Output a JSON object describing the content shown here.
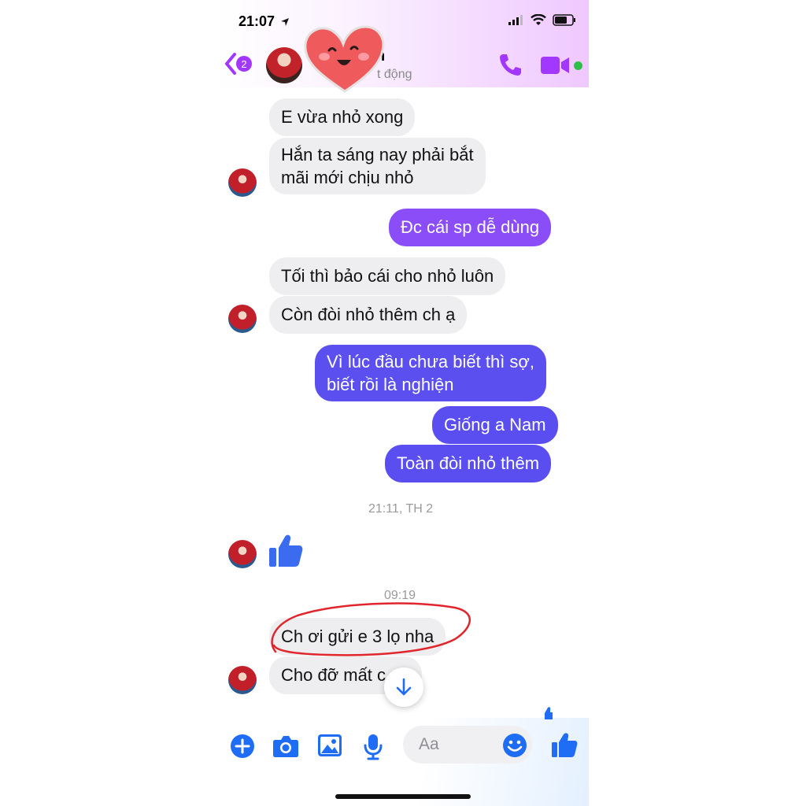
{
  "status_bar": {
    "time": "21:07"
  },
  "header": {
    "unread_count": "2",
    "contact_name": "h",
    "contact_status": "t động"
  },
  "messages": [
    {
      "text": "E vừa nhỏ xong"
    },
    {
      "text_line1": "Hắn ta sáng nay phải bắt",
      "text_line2": "mãi mới chịu nhỏ"
    },
    {
      "text": "Đc cái sp dễ dùng"
    },
    {
      "text": "Tối thì bảo cái cho nhỏ luôn"
    },
    {
      "text": "Còn đòi nhỏ thêm ch ạ"
    },
    {
      "text_line1": "Vì lúc đầu chưa biết thì sợ,",
      "text_line2": "biết rồi là nghiện"
    },
    {
      "text": "Giống a Nam"
    },
    {
      "text": "Toàn đòi nhỏ thêm"
    },
    {
      "text": "Ch ơi gửi e 3 lọ nha"
    },
    {
      "text": "Cho đỡ mất c ng"
    }
  ],
  "timestamps": [
    "21:11, TH 2",
    "09:19"
  ],
  "composer": {
    "placeholder": "Aa"
  },
  "colors": {
    "accent_purple": "#a238ff",
    "bubble_purple": "#8a4df8",
    "bubble_indigo": "#5b4ff0",
    "bubble_blue": "#5a4ef0",
    "messenger_blue": "#1f6cf5",
    "incoming_bubble": "#eeeef0",
    "annotation_red": "#e0262c",
    "online_green": "#2ec046"
  },
  "icons": [
    "back-chevron-icon",
    "phone-icon",
    "video-icon",
    "heart-sticker-icon",
    "thumbs-up-icon",
    "arrow-down-icon",
    "plus-icon",
    "camera-icon",
    "gallery-icon",
    "microphone-icon",
    "smiley-icon",
    "signal-icon",
    "wifi-icon",
    "battery-icon",
    "location-arrow-icon"
  ]
}
